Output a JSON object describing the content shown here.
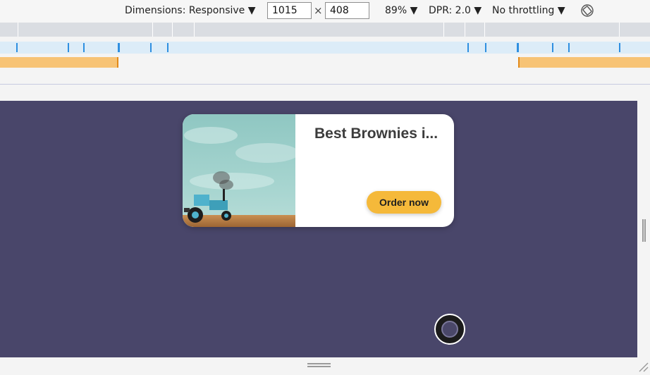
{
  "toolbar": {
    "dimensions_label": "Dimensions: Responsive ▼",
    "width_value": "1015",
    "times_glyph": "×",
    "height_value": "408",
    "zoom_label": "89% ▼",
    "dpr_label": "DPR: 2.0 ▼",
    "throttling_label": "No throttling ▼",
    "rotate_icon": "rotate-device-icon"
  },
  "colors": {
    "viewport_bg": "#49466a",
    "button": "#f5b93a",
    "mq_orange": "#f7c375",
    "mq_blue": "#dcecf8",
    "mq_gray": "#dadde2"
  },
  "card": {
    "title": "Best Brownies i...",
    "button_label": "Order now",
    "image_icon": "tractor-field-image"
  }
}
